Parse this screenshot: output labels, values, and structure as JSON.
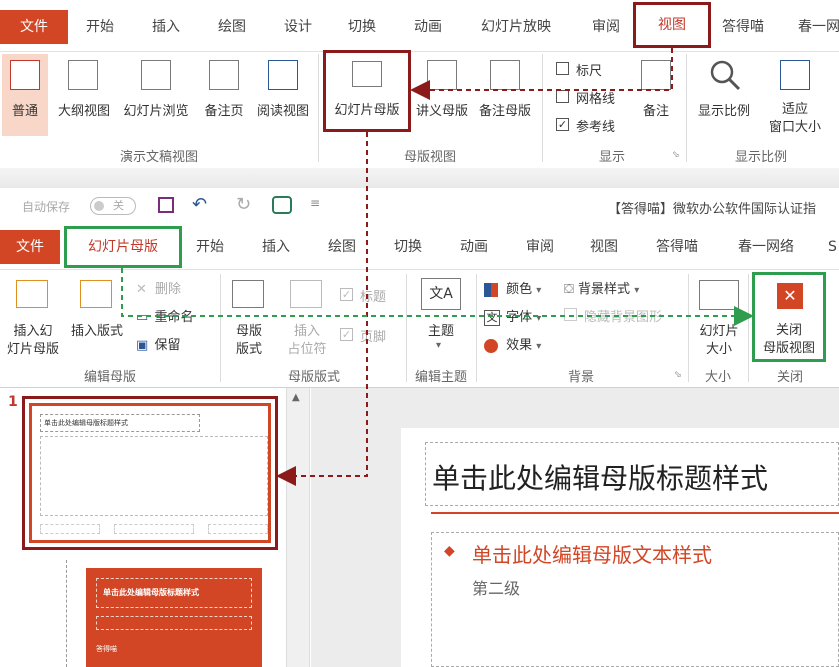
{
  "top_ribbon": {
    "tabs": [
      "文件",
      "开始",
      "插入",
      "绘图",
      "设计",
      "切换",
      "动画",
      "幻灯片放映",
      "审阅",
      "视图",
      "答得喵",
      "春一网"
    ],
    "selected_tab": "视图",
    "buttons": {
      "normal": "普通",
      "outline": "大纲视图",
      "sorter": "幻灯片浏览",
      "notes_page": "备注页",
      "reading": "阅读视图",
      "slide_master": "幻灯片母版",
      "handout_master": "讲义母版",
      "notes_master": "备注母版",
      "ruler": "标尺",
      "gridlines": "网格线",
      "guides": "参考线",
      "notes": "备注",
      "zoom": "显示比例",
      "fit_line1": "适应",
      "fit_line2": "窗口大小"
    },
    "groups": {
      "presentation_views": "演示文稿视图",
      "master_views": "母版视图",
      "show": "显示",
      "zoom": "显示比例"
    }
  },
  "quick_access": {
    "autosave_label": "自动保存",
    "autosave_state": "关",
    "title": "【答得喵】微软办公软件国际认证指"
  },
  "second_ribbon": {
    "tabs": [
      "文件",
      "幻灯片母版",
      "开始",
      "插入",
      "绘图",
      "切换",
      "动画",
      "审阅",
      "视图",
      "答得喵",
      "春一网络",
      "S"
    ],
    "selected_tab": "幻灯片母版",
    "buttons": {
      "insert_master_line1": "插入幻",
      "insert_master_line2": "灯片母版",
      "insert_layout": "插入版式",
      "delete": "删除",
      "rename": "重命名",
      "preserve": "保留",
      "master_layout_line1": "母版",
      "master_layout_line2": "版式",
      "insert_placeholder_line1": "插入",
      "insert_placeholder_line2": "占位符",
      "title": "标题",
      "footers": "页脚",
      "theme": "主题",
      "colors": "颜色",
      "fonts": "字体",
      "effects": "效果",
      "background_styles": "背景样式",
      "hide_background": "隐藏背景图形",
      "slide_size_line1": "幻灯片",
      "slide_size_line2": "大小",
      "close_line1": "关闭",
      "close_line2": "母版视图"
    },
    "groups": {
      "edit_master": "编辑母版",
      "master_layout": "母版版式",
      "edit_theme": "编辑主题",
      "background": "背景",
      "size": "大小",
      "close": "关闭"
    }
  },
  "thumbnails": {
    "slide_number": "1",
    "thumb1_title": "单击此处编辑母版标题样式",
    "thumb2_title": "单击此处编辑母版标题样式",
    "thumb2_logo": "答得喵"
  },
  "slide": {
    "title": "单击此处编辑母版标题样式",
    "body_level1": "单击此处编辑母版文本样式",
    "body_level2": "第二级"
  },
  "colors": {
    "accent": "#d24625",
    "highlight_red": "#8b1a1a",
    "highlight_green": "#2e9d4e"
  }
}
